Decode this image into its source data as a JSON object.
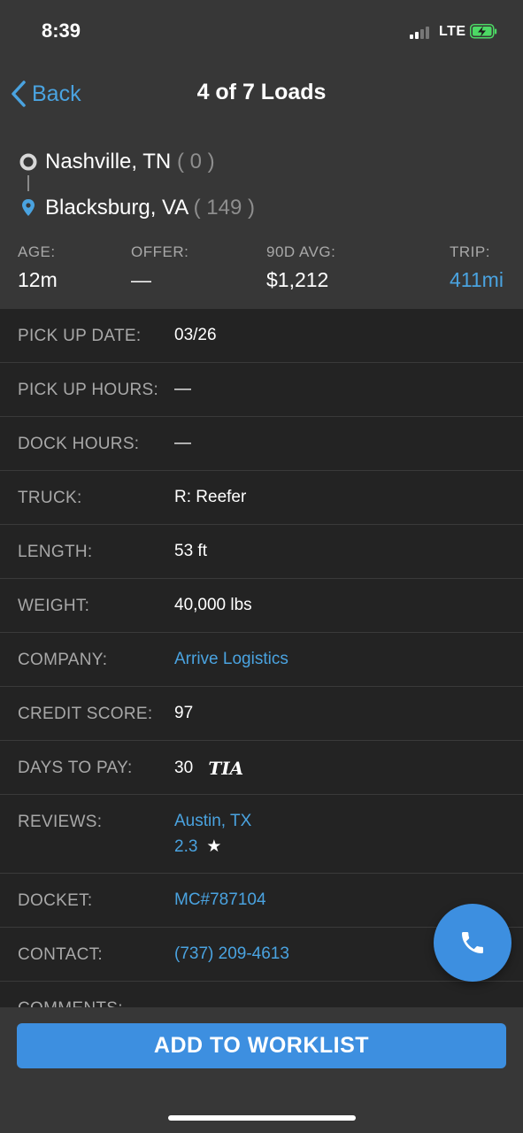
{
  "status_bar": {
    "time": "8:39",
    "network": "LTE"
  },
  "nav": {
    "back_label": "Back",
    "title": "4 of 7 Loads"
  },
  "route": {
    "origin": {
      "city": "Nashville, TN",
      "deadhead": "( 0 )"
    },
    "destination": {
      "city": "Blacksburg, VA",
      "deadhead": "( 149 )"
    }
  },
  "stats": {
    "age": {
      "label": "AGE:",
      "value": "12m"
    },
    "offer": {
      "label": "OFFER:",
      "value": "—"
    },
    "avg": {
      "label": "90D AVG:",
      "value": "$1,212"
    },
    "trip": {
      "label": "TRIP:",
      "value": "411mi"
    }
  },
  "details": {
    "pickup_date": {
      "label": "PICK UP DATE:",
      "value": "03/26"
    },
    "pickup_hours": {
      "label": "PICK UP HOURS:",
      "value": "—"
    },
    "dock_hours": {
      "label": "DOCK HOURS:",
      "value": "—"
    },
    "truck": {
      "label": "TRUCK:",
      "value": "R: Reefer"
    },
    "length": {
      "label": "LENGTH:",
      "value": "53 ft"
    },
    "weight": {
      "label": "WEIGHT:",
      "value": "40,000 lbs"
    },
    "company": {
      "label": "COMPANY:",
      "value": "Arrive Logistics"
    },
    "credit_score": {
      "label": "CREDIT SCORE:",
      "value": "97"
    },
    "days_to_pay": {
      "label": "DAYS TO PAY:",
      "value": "30",
      "badge": "TIA"
    },
    "reviews": {
      "label": "REVIEWS:",
      "location": "Austin, TX",
      "rating": "2.3",
      "star": "★"
    },
    "docket": {
      "label": "DOCKET:",
      "value": "MC#787104"
    },
    "contact": {
      "label": "CONTACT:",
      "value": "(737) 209-4613"
    },
    "comments": {
      "label": "COMMENTS:"
    }
  },
  "actions": {
    "add_to_worklist": "ADD TO WORKLIST"
  },
  "colors": {
    "accent": "#3d8fe0",
    "link": "#4aa3e0",
    "header_bg": "#373737",
    "list_bg": "#232323"
  }
}
